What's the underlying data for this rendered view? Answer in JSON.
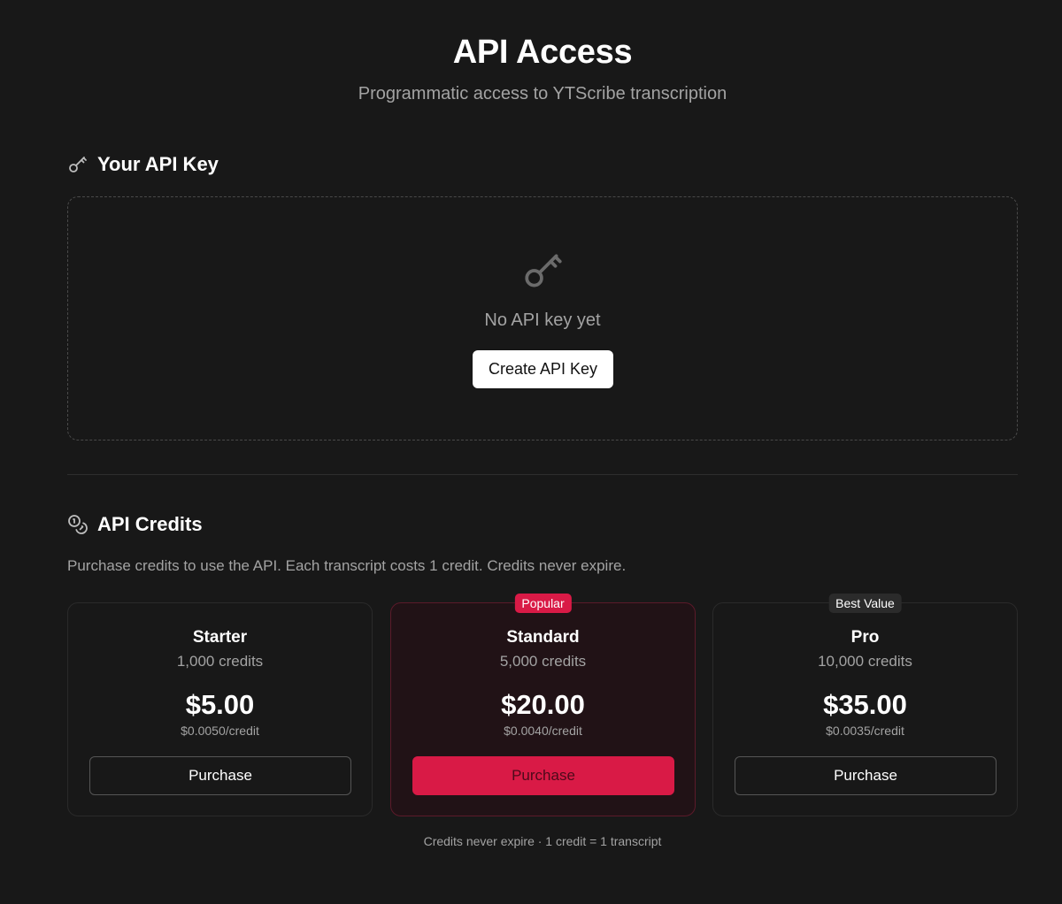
{
  "header": {
    "title": "API Access",
    "subtitle": "Programmatic access to YTScribe transcription"
  },
  "api_key_section": {
    "heading": "Your API Key",
    "heading_icon": "key-icon",
    "empty_icon": "key-icon",
    "empty_text": "No API key yet",
    "create_button_label": "Create API Key"
  },
  "credits_section": {
    "heading": "API Credits",
    "heading_icon": "coins-icon",
    "description": "Purchase credits to use the API. Each transcript costs 1 credit. Credits never expire.",
    "plans": [
      {
        "name": "Starter",
        "credits": "1,000 credits",
        "price": "$5.00",
        "per_credit": "$0.0050/credit",
        "button_label": "Purchase",
        "badge": ""
      },
      {
        "name": "Standard",
        "credits": "5,000 credits",
        "price": "$20.00",
        "per_credit": "$0.0040/credit",
        "button_label": "Purchase",
        "badge": "Popular"
      },
      {
        "name": "Pro",
        "credits": "10,000 credits",
        "price": "$35.00",
        "per_credit": "$0.0035/credit",
        "button_label": "Purchase",
        "badge": "Best Value"
      }
    ],
    "footnote": "Credits never expire · 1 credit = 1 transcript"
  },
  "colors": {
    "background": "#181818",
    "accent": "#d91a46",
    "muted_text": "#a3a3a3",
    "highlight_card_bg": "#211216"
  }
}
